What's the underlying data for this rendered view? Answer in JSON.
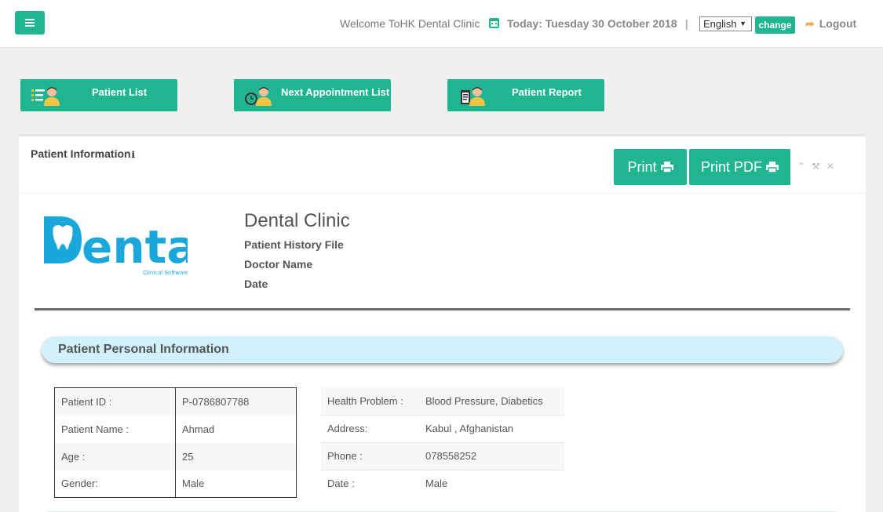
{
  "header": {
    "welcome": "Welcome ToHK Dental Clinic",
    "today": "Today: Tuesday 30 October 2018",
    "separator": "|",
    "language": "English",
    "change_label": "change",
    "logout_label": "Logout"
  },
  "quick_actions": [
    {
      "label": "Patient List",
      "icon": "patient-list-icon"
    },
    {
      "label": "Next Appointment List",
      "icon": "appointment-icon"
    },
    {
      "label": "Patient Report",
      "icon": "patient-report-icon"
    }
  ],
  "panel": {
    "title": "Patient Information",
    "title_icon": "ℹ",
    "print_label": "Print",
    "print_pdf_label": "Print PDF",
    "tools": "⌃⚒✕"
  },
  "report": {
    "clinic_name": "Dental Clinic",
    "history_label": "Patient History File",
    "doctor_label": "Doctor Name",
    "date_label": "Date",
    "logo_text": "Denta",
    "logo_sub": "Clinical Software",
    "section_title": "Patient Personal Information"
  },
  "personal_left": [
    {
      "label": "Patient ID :",
      "value": "P-0786807788"
    },
    {
      "label": "Patient Name :",
      "value": "Ahmad"
    },
    {
      "label": "Age :",
      "value": "25"
    },
    {
      "label": "Gender:",
      "value": "Male"
    }
  ],
  "personal_right": [
    {
      "label": "Health Problem :",
      "value": "Blood Pressure, Diabetics"
    },
    {
      "label": "Address:",
      "value": "Kabul , Afghanistan"
    },
    {
      "label": "Phone :",
      "value": "078558252"
    },
    {
      "label": "Date :",
      "value": "Male"
    }
  ],
  "colors": {
    "accent": "#1fb590",
    "section_bg": "#d1f1fc",
    "logo_blue": "#1aa7dc"
  }
}
